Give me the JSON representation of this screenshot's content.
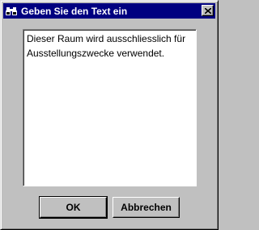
{
  "window": {
    "title": "Geben Sie den Text ein",
    "icon": "binoculars-icon",
    "title_bar_color": "#000080"
  },
  "textarea": {
    "value": "Dieser Raum wird ausschliesslich für\nAusstellungszwecke verwendet."
  },
  "buttons": {
    "ok_label": "OK",
    "cancel_label": "Abbrechen"
  }
}
